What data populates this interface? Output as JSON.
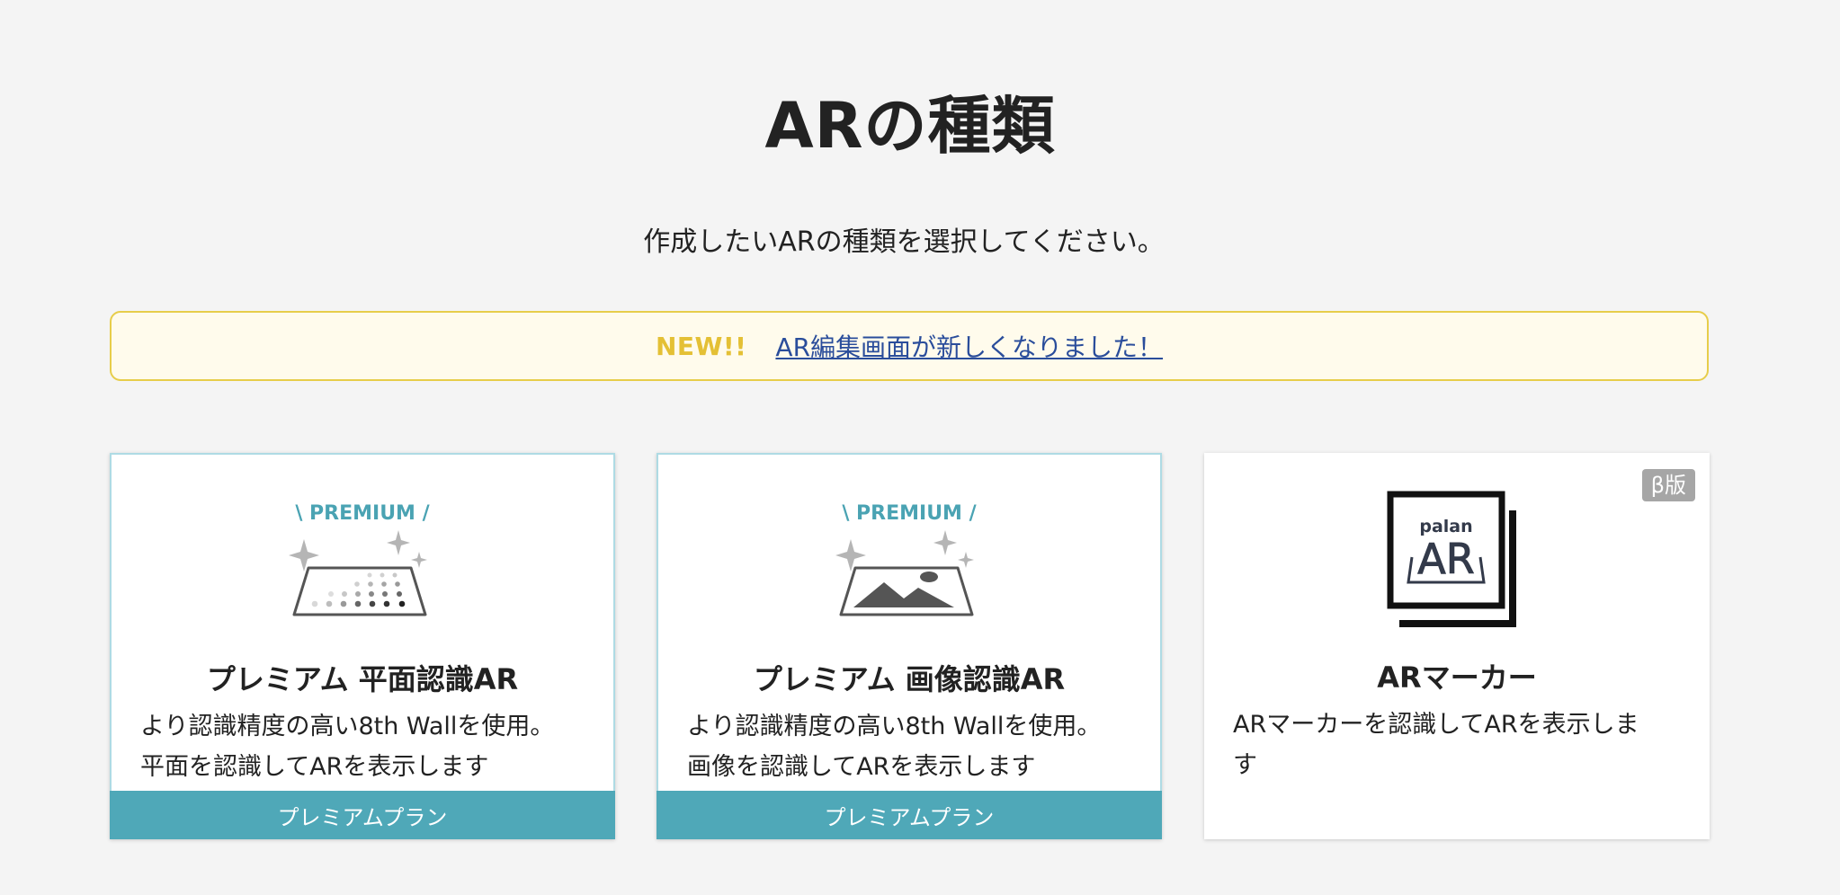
{
  "header": {
    "title": "ARの種類",
    "subtitle": "作成したいARの種類を選択してください。"
  },
  "notice": {
    "badge": "NEW!!",
    "link_text": "AR編集画面が新しくなりました！"
  },
  "cards": [
    {
      "icon": "premium-plane-recognition-icon",
      "icon_label": "\\ PREMIUM /",
      "title": "プレミアム 平面認識AR",
      "desc_line1": "より認識精度の高い8th Wallを使用。",
      "desc_line2": "平面を認識してARを表示します",
      "plan": "プレミアムプラン"
    },
    {
      "icon": "premium-image-recognition-icon",
      "icon_label": "\\ PREMIUM /",
      "title": "プレミアム 画像認識AR",
      "desc_line1": "より認識精度の高い8th Wallを使用。",
      "desc_line2": "画像を認識してARを表示します",
      "plan": "プレミアムプラン"
    },
    {
      "icon": "ar-marker-icon",
      "icon_logo_top": "palan",
      "icon_logo_main": "AR",
      "title": "ARマーカー",
      "desc_line1": "ARマーカーを認識してARを表示しま",
      "desc_line2": "す",
      "badge": "β版"
    }
  ],
  "colors": {
    "background": "#f4f4f4",
    "accent_teal": "#4fa8b8",
    "premium_text": "#4aa3b3",
    "notice_border": "#e7cd4a",
    "notice_bg": "#fffbec",
    "new_badge": "#e4c035",
    "link": "#2a4d9b"
  }
}
